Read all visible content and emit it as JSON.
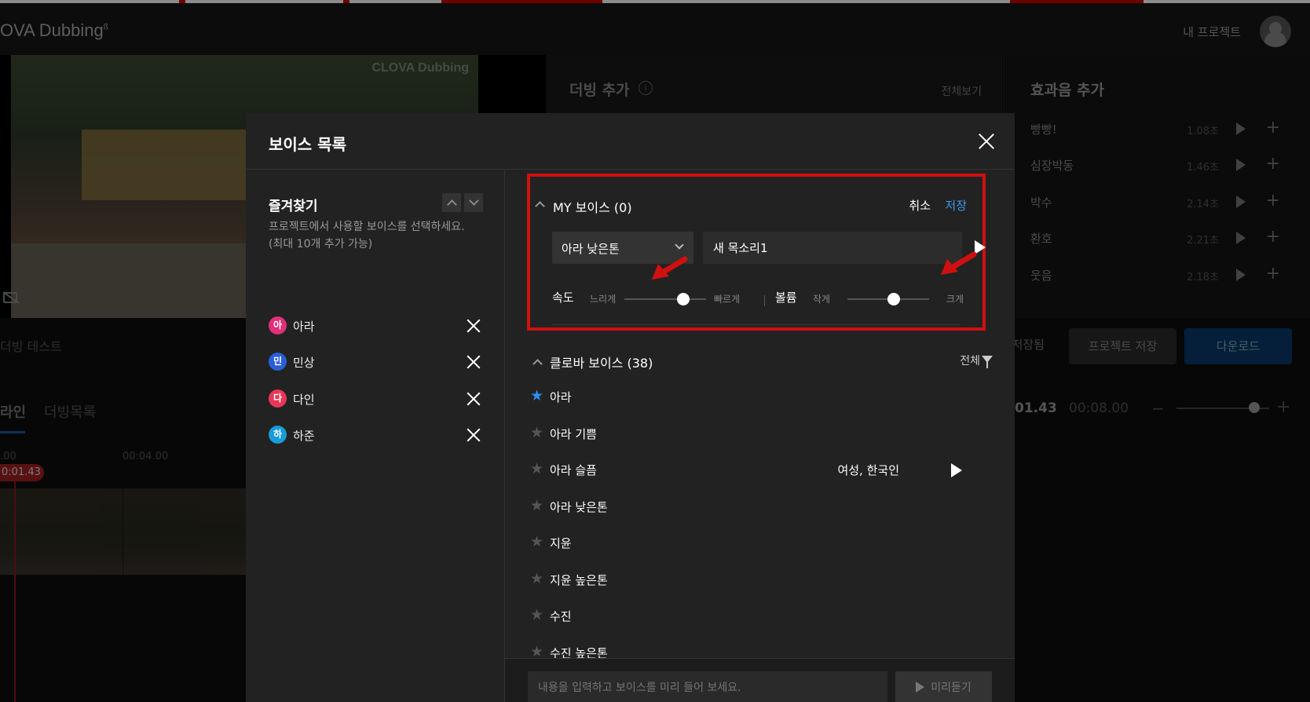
{
  "app": {
    "logo": "OVA Dubbing",
    "my_projects": "내 프로젝트",
    "video_watermark": "CLOVA Dubbing",
    "dub_add_title": "더빙 추가",
    "dub_add_view_all": "전체보기",
    "sfx_title": "효과음 추가",
    "sfx_items": [
      {
        "name": "빵빵!",
        "duration": "1.08초"
      },
      {
        "name": "심장박동",
        "duration": "1.46초"
      },
      {
        "name": "박수",
        "duration": "2.14초"
      },
      {
        "name": "환호",
        "duration": "2.21초"
      },
      {
        "name": "웃음",
        "duration": "2.18초"
      }
    ],
    "save_status": "등 저장됨",
    "save_project": "프로젝트 저장",
    "download": "다운로드",
    "project_name": "더빙 테스트",
    "tabs": [
      "라인",
      "더빙목록"
    ],
    "current_time": "01.43",
    "total_time": "00:08.00",
    "timeline_start": ".00",
    "timeline_mark": "00:04.00",
    "timeline_cursor": "0:01.43"
  },
  "modal": {
    "title": "보이스 목록",
    "favorites": {
      "title": "즐겨찾기",
      "desc_line1": "프로젝트에서 사용할 보이스를 선택하세요.",
      "desc_line2": "(최대 10개 추가 가능)",
      "items": [
        {
          "badge": "아",
          "name": "아라",
          "color": "#e0307a"
        },
        {
          "badge": "민",
          "name": "민상",
          "color": "#2a5fd8"
        },
        {
          "badge": "다",
          "name": "다인",
          "color": "#e8365a"
        },
        {
          "badge": "하",
          "name": "하준",
          "color": "#1a9ad8"
        }
      ]
    },
    "my_voice": {
      "title": "MY 보이스 (0)",
      "cancel": "취소",
      "save": "저장",
      "base_voice": "아라 낮은톤",
      "name_value": "새 목소리1",
      "speed": {
        "label": "속도",
        "min": "느리게",
        "max": "빠르게",
        "level": 0.7
      },
      "volume": {
        "label": "볼륨",
        "min": "작게",
        "max": "크게",
        "level": 0.57
      }
    },
    "clova": {
      "title": "클로바 보이스 (38)",
      "filter": "전체",
      "voices": [
        {
          "name": "아라",
          "starred": true,
          "meta": ""
        },
        {
          "name": "아라 기쁨",
          "starred": false,
          "meta": ""
        },
        {
          "name": "아라 슬픔",
          "starred": false,
          "meta": "여성, 한국인"
        },
        {
          "name": "아라 낮은톤",
          "starred": false,
          "meta": ""
        },
        {
          "name": "지윤",
          "starred": false,
          "meta": ""
        },
        {
          "name": "지윤 높은톤",
          "starred": false,
          "meta": ""
        },
        {
          "name": "수진",
          "starred": false,
          "meta": ""
        },
        {
          "name": "수진 높은톤",
          "starred": false,
          "meta": ""
        }
      ]
    },
    "preview": {
      "placeholder": "내용을 입력하고 보이스를 미리 들어 보세요.",
      "button": "미리듣기"
    }
  },
  "colors": {
    "accent_blue": "#3d9bf0",
    "annotation_red": "#d01010"
  }
}
